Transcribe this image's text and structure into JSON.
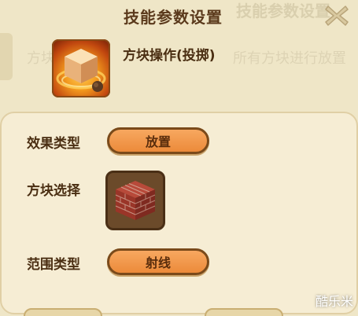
{
  "dialog": {
    "title": "技能参数设置"
  },
  "background": {
    "title": "技能参数设置",
    "line_left": "方块",
    "line_right": "所有方块进行放置"
  },
  "skill": {
    "name": "方块操作(投掷)",
    "icon": "orange-cube-skill-icon"
  },
  "fields": {
    "effect_type": {
      "label": "效果类型",
      "value": "放置"
    },
    "block_select": {
      "label": "方块选择",
      "block": "red-brick-block"
    },
    "range_type": {
      "label": "范围类型",
      "value": "射线"
    }
  },
  "watermark": "酷乐米",
  "colors": {
    "accent": "#ec8a3a",
    "border": "#7a4a1a",
    "text": "#4a2e12",
    "background": "#efe6c7"
  }
}
